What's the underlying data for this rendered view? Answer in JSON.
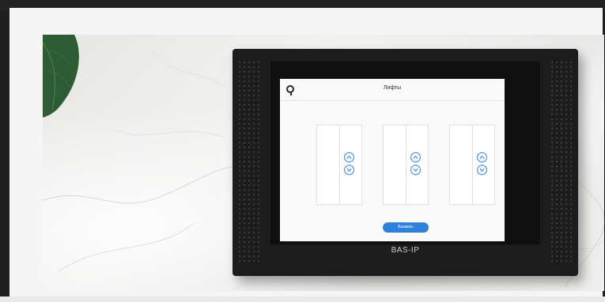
{
  "screen": {
    "title": "Лифты",
    "action_button_label": "Вызвать"
  },
  "device": {
    "brand": "BAS-IP"
  },
  "lifts": [
    {
      "up_icon": "elevator-up-icon",
      "down_icon": "elevator-down-icon"
    },
    {
      "up_icon": "elevator-up-icon",
      "down_icon": "elevator-down-icon"
    },
    {
      "up_icon": "elevator-up-icon",
      "down_icon": "elevator-down-icon"
    }
  ],
  "colors": {
    "accent": "#2f80d9",
    "panel": "#1c1c1c",
    "screen_bg": "#fafafa"
  }
}
